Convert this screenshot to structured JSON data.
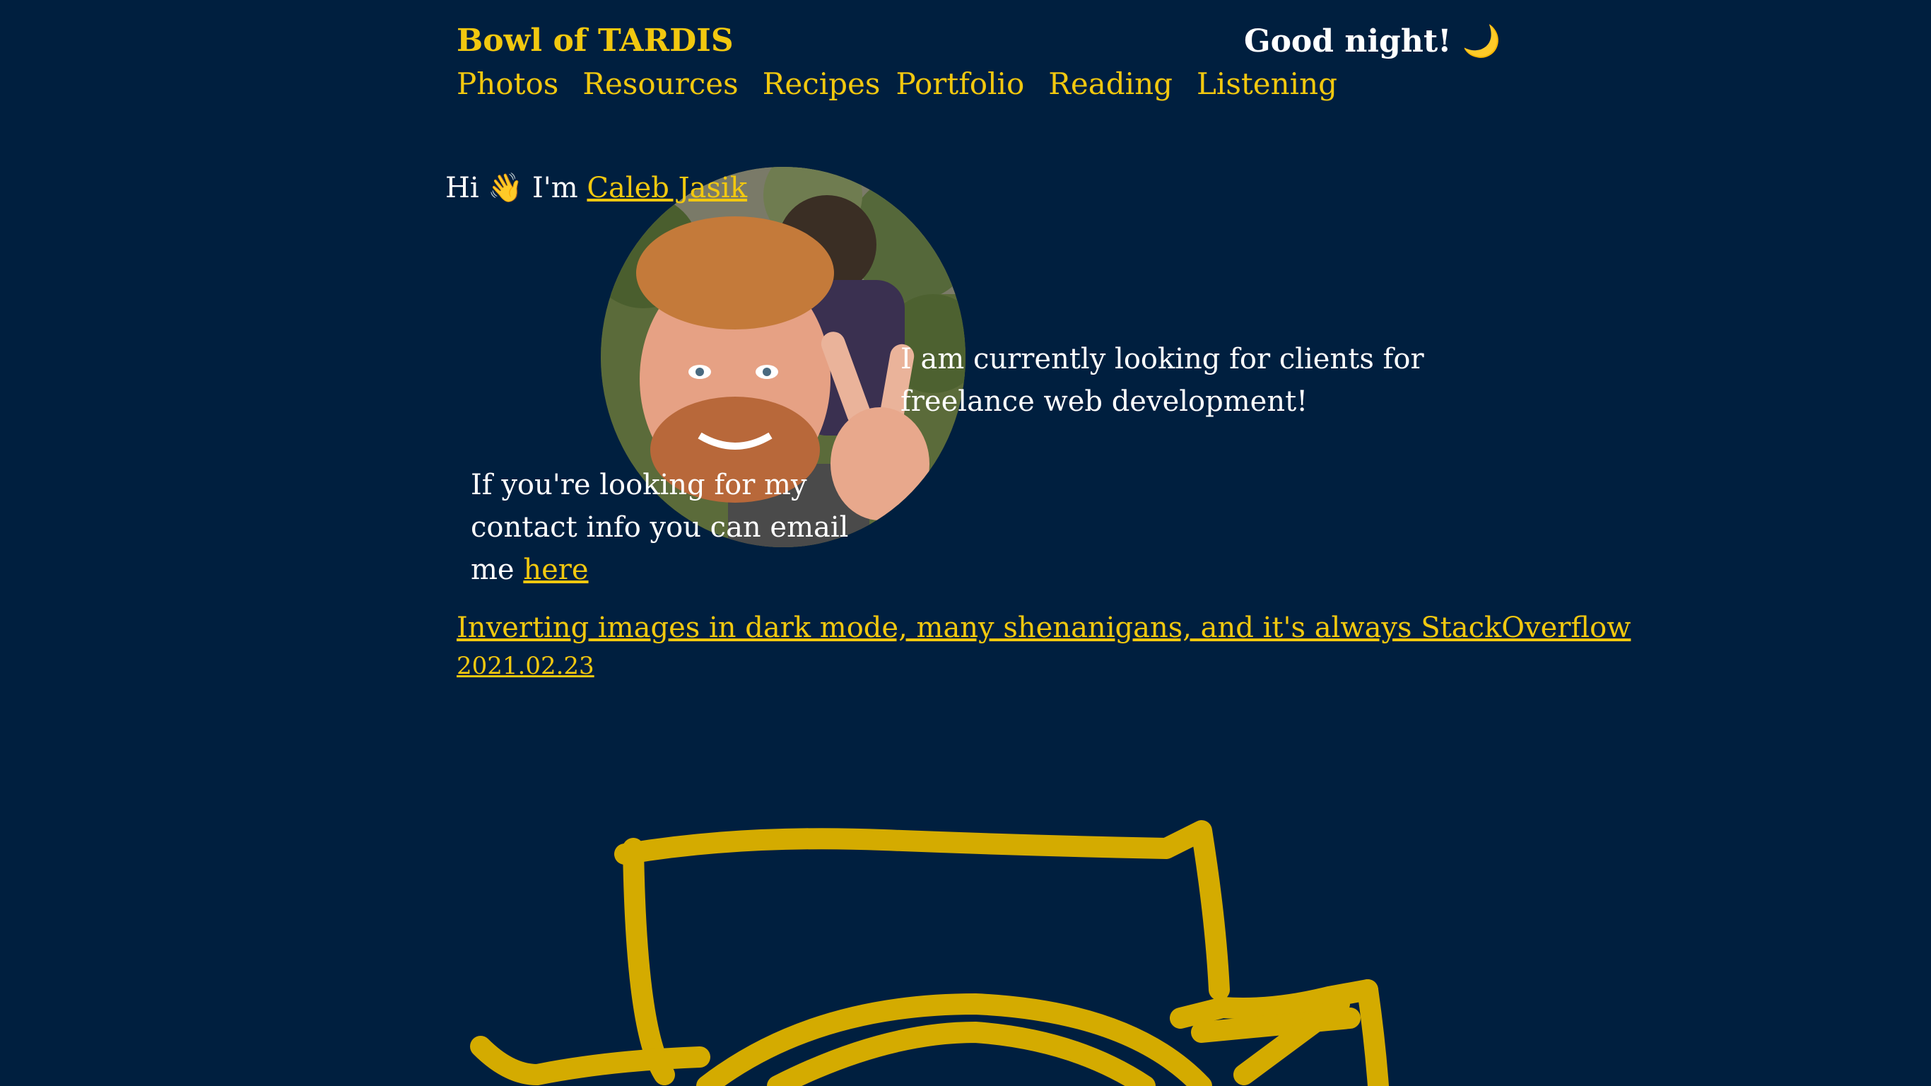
{
  "header": {
    "site_title": "Bowl of TARDIS",
    "greeting": "Good night!",
    "greeting_icon": "🌙"
  },
  "nav": {
    "items": [
      {
        "label": "Photos"
      },
      {
        "label": "Resources"
      },
      {
        "label": "Recipes"
      },
      {
        "label": "Portfolio"
      },
      {
        "label": "Reading"
      },
      {
        "label": "Listening"
      }
    ]
  },
  "intro": {
    "hi": "Hi",
    "wave_icon": "👋",
    "im": "I'm",
    "name_link": "Caleb Jasik"
  },
  "freelance_text": "I am currently looking for clients for freelance web development!",
  "contact": {
    "text": "If you're looking for my contact info you can email me",
    "link": "here"
  },
  "post": {
    "title": "Inverting images in dark mode, many shenanigans, and it's always StackOverflow",
    "date": "2021.02.23"
  },
  "colors": {
    "background": "#001f3f",
    "accent": "#f2c80f",
    "doodle": "#d4ab00",
    "text": "#ffffff"
  }
}
